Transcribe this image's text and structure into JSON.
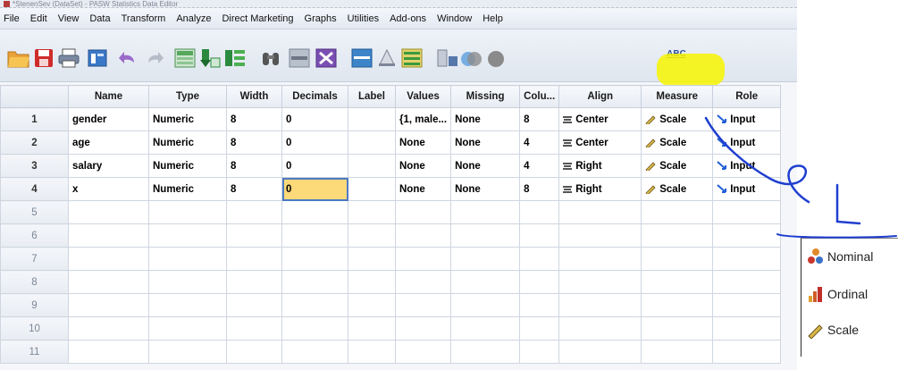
{
  "window": {
    "title": "*StenenSev (DataSet) - PASW Statistics Data Editor"
  },
  "menu": [
    "File",
    "Edit",
    "View",
    "Data",
    "Transform",
    "Analyze",
    "Direct Marketing",
    "Graphs",
    "Utilities",
    "Add-ons",
    "Window",
    "Help"
  ],
  "toolbar": {
    "icons": [
      "open-folder-icon",
      "save-icon",
      "print-icon",
      "recall-dialog-icon",
      "undo-icon",
      "redo-icon",
      "goto-case-icon",
      "goto-variable-icon",
      "variables-icon",
      "find-icon",
      "insert-cases-icon",
      "insert-variable-icon",
      "split-file-icon",
      "weight-cases-icon",
      "select-cases-icon",
      "value-labels-icon",
      "use-sets-icon",
      "show-all-variables-icon",
      "spell-check-icon"
    ],
    "spell_label": "ABC"
  },
  "grid": {
    "columns": [
      "",
      "Name",
      "Type",
      "Width",
      "Decimals",
      "Label",
      "Values",
      "Missing",
      "Colu...",
      "Align",
      "Measure",
      "Role"
    ],
    "rows": [
      {
        "num": "1",
        "name": "gender",
        "type": "Numeric",
        "width": "8",
        "decimals": "0",
        "label": "",
        "values": "{1, male...",
        "missing": "None",
        "columns": "8",
        "align": "Center",
        "measure": "Scale",
        "role": "Input"
      },
      {
        "num": "2",
        "name": "age",
        "type": "Numeric",
        "width": "8",
        "decimals": "0",
        "label": "",
        "values": "None",
        "missing": "None",
        "columns": "4",
        "align": "Center",
        "measure": "Scale",
        "role": "Input"
      },
      {
        "num": "3",
        "name": "salary",
        "type": "Numeric",
        "width": "8",
        "decimals": "0",
        "label": "",
        "values": "None",
        "missing": "None",
        "columns": "4",
        "align": "Right",
        "measure": "Scale",
        "role": "Input"
      },
      {
        "num": "4",
        "name": "x",
        "type": "Numeric",
        "width": "8",
        "decimals": "0",
        "label": "",
        "values": "None",
        "missing": "None",
        "columns": "8",
        "align": "Right",
        "measure": "Scale",
        "role": "Input"
      }
    ],
    "empty_rows": [
      "5",
      "6",
      "7",
      "8",
      "9",
      "10",
      "11"
    ],
    "selected_cell": {
      "row": "4",
      "column": "Decimals"
    }
  },
  "measure_dropdown": {
    "options": [
      {
        "label": "Nominal",
        "icon": "nominal-icon"
      },
      {
        "label": "Ordinal",
        "icon": "ordinal-icon"
      },
      {
        "label": "Scale",
        "icon": "scale-ruler-icon"
      }
    ]
  },
  "colors": {
    "highlight": "#f7f400",
    "annotation_ink": "#1f3fd0",
    "selected_cell": "#fcd979",
    "role_arrow": "#1f5fd6"
  }
}
